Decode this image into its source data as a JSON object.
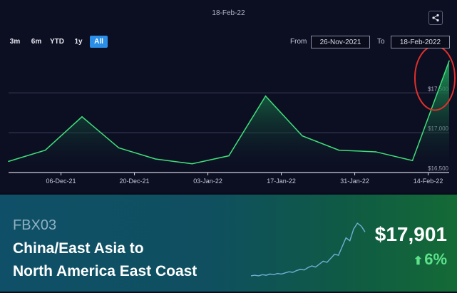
{
  "chart_header": {
    "date": "18-Feb-22"
  },
  "range_selector": {
    "buttons": [
      "3m",
      "6m",
      "YTD",
      "1y",
      "All"
    ],
    "active": "All"
  },
  "date_range": {
    "from_label": "From",
    "from_value": "26-Nov-2021",
    "to_label": "To",
    "to_value": "18-Feb-2022"
  },
  "icons": {
    "share": "share-icon",
    "arrow": "arrow-up-icon"
  },
  "chart_data": {
    "type": "area",
    "title": "",
    "xlabel": "",
    "ylabel": "",
    "x": [
      "2021-11-26",
      "2021-12-03",
      "2021-12-10",
      "2021-12-17",
      "2021-12-24",
      "2021-12-31",
      "2022-01-07",
      "2022-01-14",
      "2022-01-21",
      "2022-01-28",
      "2022-02-04",
      "2022-02-11",
      "2022-02-18"
    ],
    "series": [
      {
        "name": "",
        "values": [
          16640,
          16780,
          17200,
          16810,
          16670,
          16610,
          16710,
          17460,
          16960,
          16780,
          16760,
          16650,
          17901
        ]
      }
    ],
    "x_tick_labels": [
      "06-Dec-21",
      "20-Dec-21",
      "03-Jan-22",
      "17-Jan-22",
      "31-Jan-22",
      "14-Feb-22"
    ],
    "x_tick_dates": [
      "2021-12-06",
      "2021-12-20",
      "2022-01-03",
      "2022-01-17",
      "2022-01-31",
      "2022-02-14"
    ],
    "y_ticks": [
      16500,
      17000,
      17500
    ],
    "y_tick_labels": [
      "$16,500",
      "$17,000",
      "$17,500"
    ],
    "ylim": [
      16500,
      17950
    ],
    "grid": true,
    "colors": {
      "line": "#3fe07a",
      "fill_top": "#1ea65a",
      "annotation": "#e0302a"
    }
  },
  "banner": {
    "ticker": "FBX03",
    "route_line1": "China/East Asia to",
    "route_line2": "North America East Coast",
    "price": "$17,901",
    "change": "6%",
    "sparkline_trend": [
      0.05,
      0.06,
      0.05,
      0.07,
      0.06,
      0.08,
      0.07,
      0.09,
      0.08,
      0.1,
      0.12,
      0.11,
      0.14,
      0.16,
      0.15,
      0.19,
      0.22,
      0.2,
      0.25,
      0.3,
      0.28,
      0.35,
      0.42,
      0.4,
      0.55,
      0.7,
      0.65,
      0.85,
      0.95,
      0.9,
      0.8
    ]
  }
}
